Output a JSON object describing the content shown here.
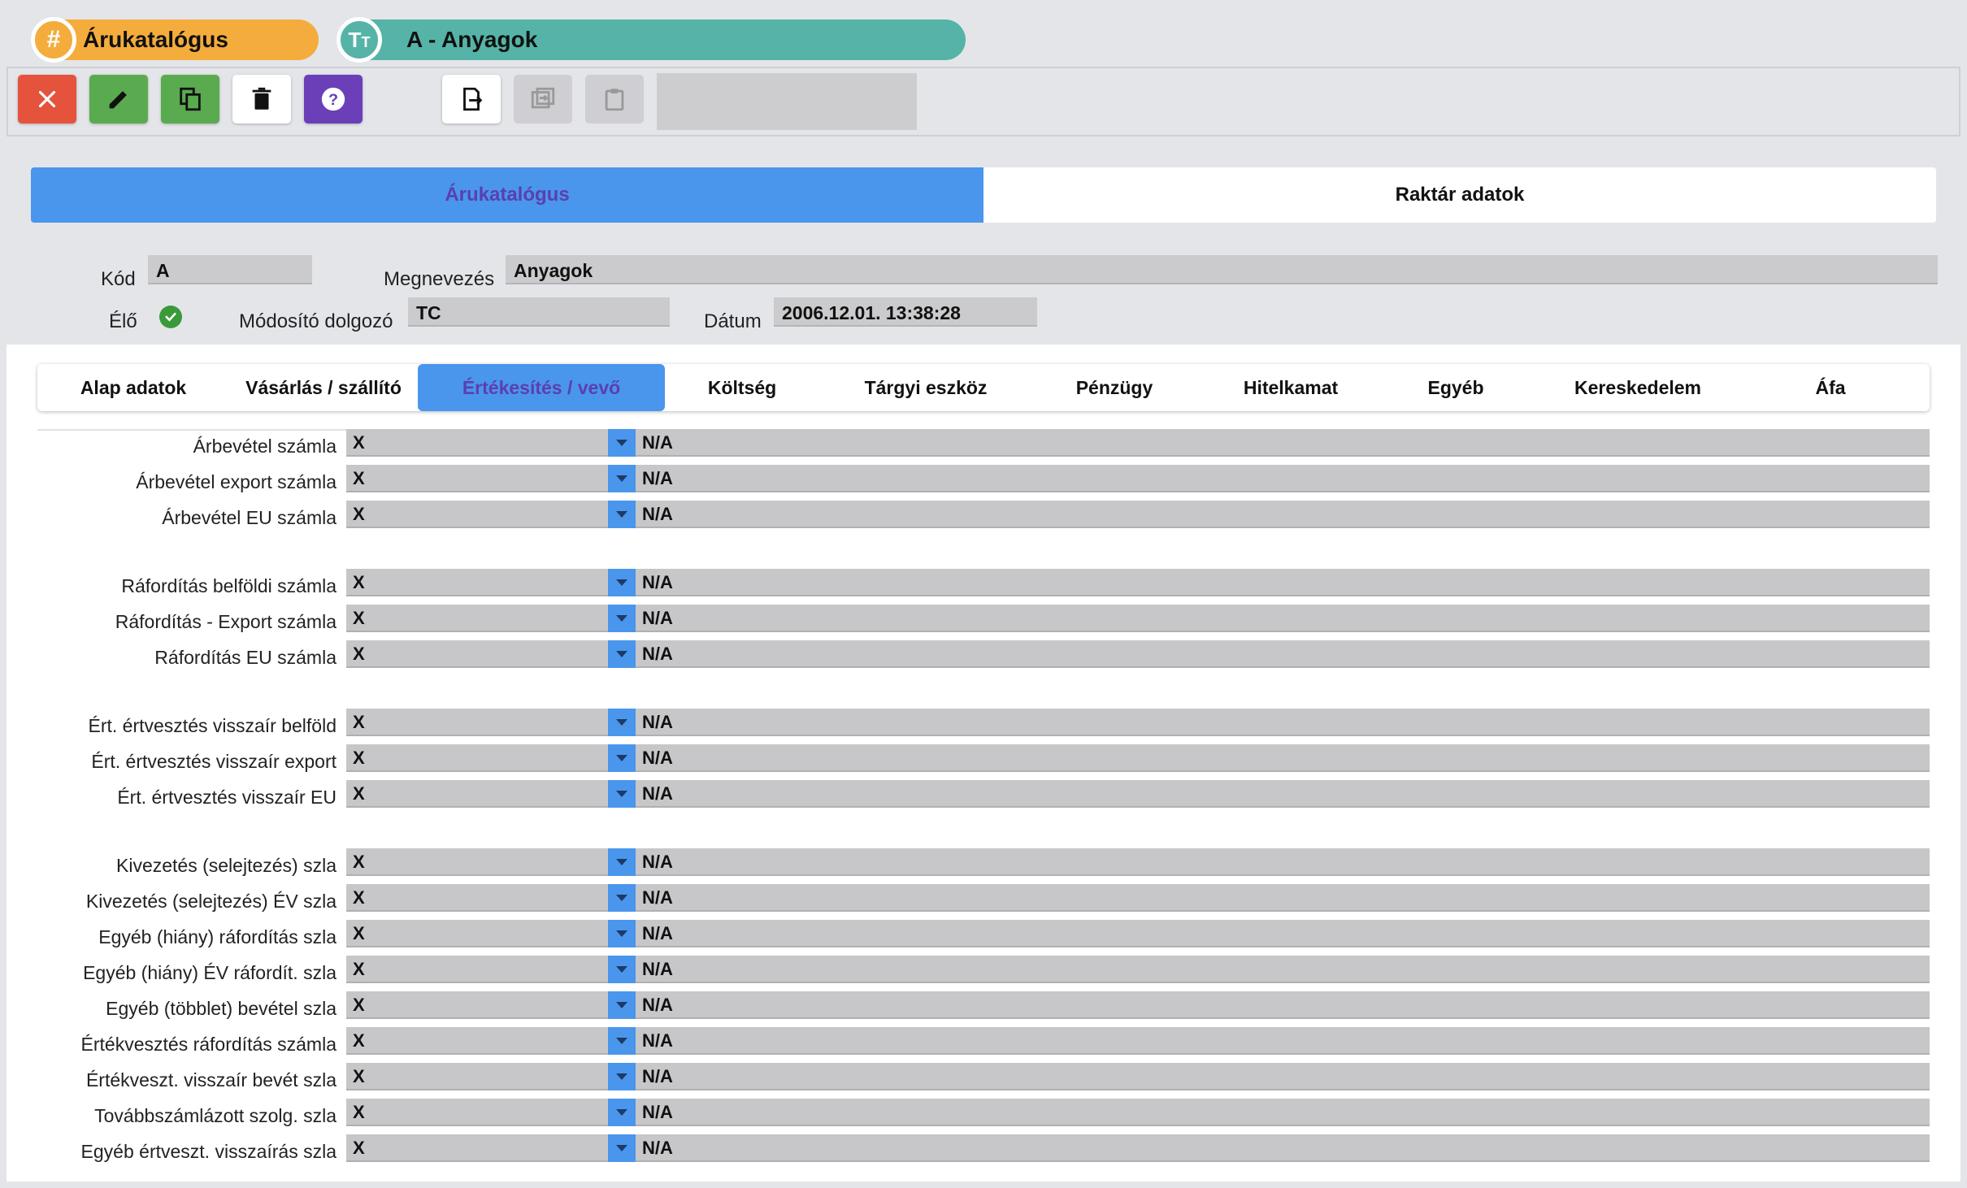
{
  "breadcrumb": [
    {
      "icon": "hash-icon",
      "label": "Árukatalógus"
    },
    {
      "icon": "text-icon",
      "label": "A - Anyagok"
    }
  ],
  "toolbar": {
    "buttons": [
      "close",
      "edit",
      "copy",
      "delete",
      "help",
      "export",
      "import",
      "paste"
    ]
  },
  "main_tabs": [
    {
      "label": "Árukatalógus",
      "active": true
    },
    {
      "label": "Raktár adatok",
      "active": false
    }
  ],
  "header": {
    "kod_label": "Kód",
    "kod_value": "A",
    "megnevezes_label": "Megnevezés",
    "megnevezes_value": "Anyagok",
    "elo_label": "Élő",
    "elo_checked": true,
    "modosito_label": "Módosító dolgozó",
    "modosito_value": "TC",
    "datum_label": "Dátum",
    "datum_value": "2006.12.01. 13:38:28"
  },
  "sub_tabs": [
    "Alap adatok",
    "Vásárlás / szállító",
    "Értékesítés / vevő",
    "Költség",
    "Tárgyi eszköz",
    "Pénzügy",
    "Hitelkamat",
    "Egyéb",
    "Kereskedelem",
    "Áfa"
  ],
  "active_sub_tab": "Értékesítés / vevő",
  "rows": [
    {
      "label": "Árbevétel számla",
      "code": "X",
      "value": "N/A"
    },
    {
      "label": "Árbevétel export számla",
      "code": "X",
      "value": "N/A"
    },
    {
      "label": "Árbevétel EU számla",
      "code": "X",
      "value": "N/A"
    },
    {
      "label": "Ráfordítás belföldi számla",
      "code": "X",
      "value": "N/A"
    },
    {
      "label": "Ráfordítás - Export számla",
      "code": "X",
      "value": "N/A"
    },
    {
      "label": "Ráfordítás EU számla",
      "code": "X",
      "value": "N/A"
    },
    {
      "label": "Ért. értvesztés visszaír belföld",
      "code": "X",
      "value": "N/A"
    },
    {
      "label": "Ért. értvesztés visszaír export",
      "code": "X",
      "value": "N/A"
    },
    {
      "label": "Ért. értvesztés visszaír EU",
      "code": "X",
      "value": "N/A"
    },
    {
      "label": "Kivezetés (selejtezés) szla",
      "code": "X",
      "value": "N/A"
    },
    {
      "label": "Kivezetés (selejtezés) ÉV szla",
      "code": "X",
      "value": "N/A"
    },
    {
      "label": "Egyéb (hiány) ráfordítás szla",
      "code": "X",
      "value": "N/A"
    },
    {
      "label": "Egyéb (hiány) ÉV ráfordít. szla",
      "code": "X",
      "value": "N/A"
    },
    {
      "label": "Egyéb (többlet) bevétel szla",
      "code": "X",
      "value": "N/A"
    },
    {
      "label": "Értékvesztés ráfordítás számla",
      "code": "X",
      "value": "N/A"
    },
    {
      "label": "Értékveszt. visszaír bevét szla",
      "code": "X",
      "value": "N/A"
    },
    {
      "label": "Továbbszámlázott szolg. szla",
      "code": "X",
      "value": "N/A"
    },
    {
      "label": "Egyéb értveszt. visszaírás szla",
      "code": "X",
      "value": "N/A"
    }
  ],
  "colors": {
    "accent_blue": "#4a96ec",
    "orange": "#f4ac3c",
    "teal": "#56b3a7",
    "red": "#e5533d",
    "green": "#5aab4f",
    "purple": "#6a3fb8"
  }
}
